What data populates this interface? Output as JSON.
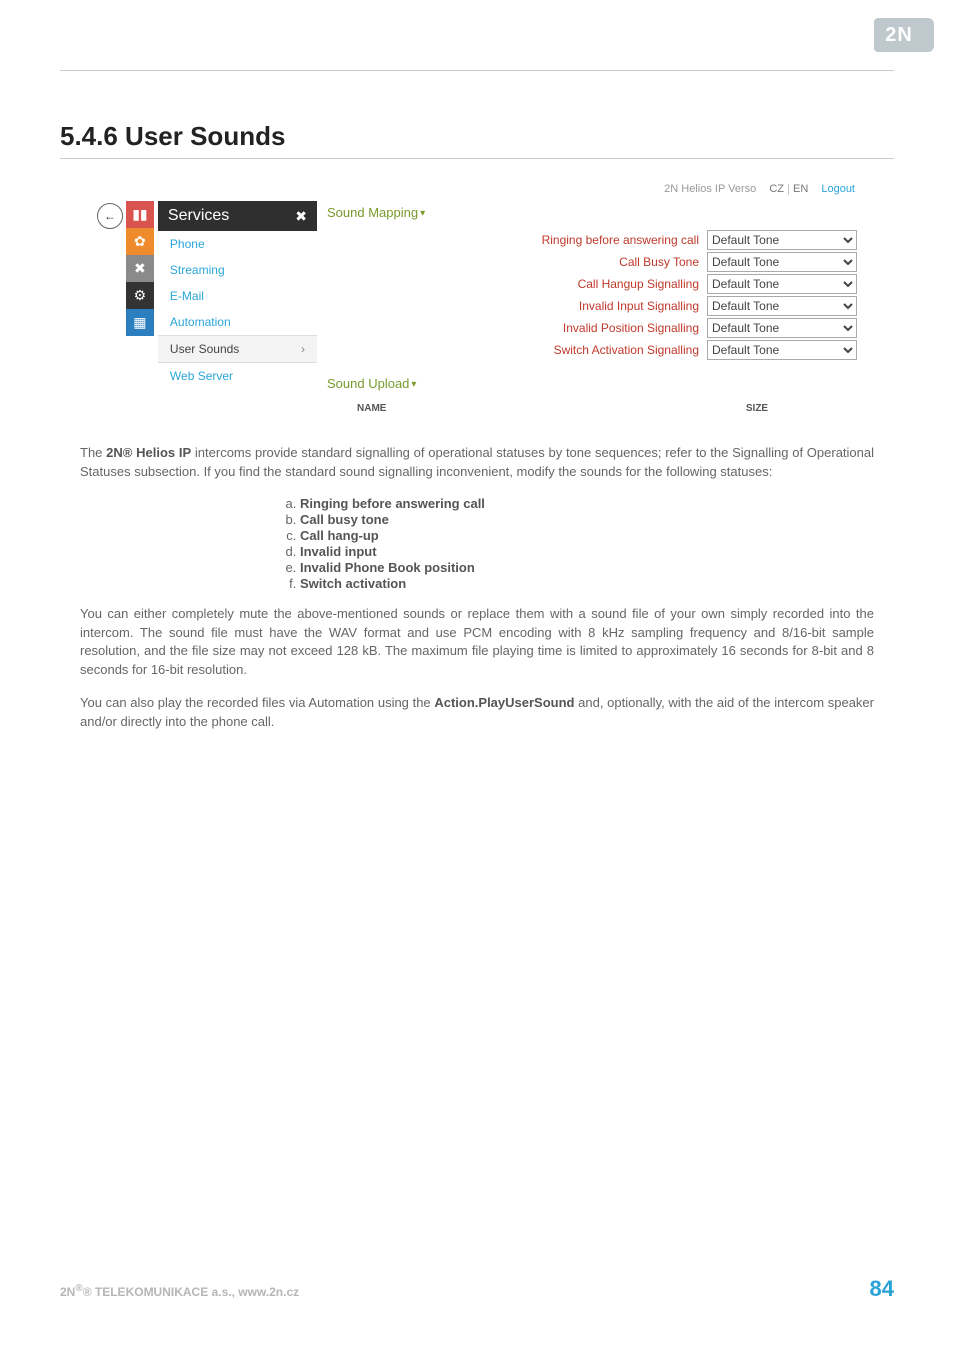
{
  "header": {
    "logo_text": "2N"
  },
  "title": "5.4.6 User Sounds",
  "screenshot": {
    "topbar": {
      "brand": "2N Helios IP Verso",
      "lang_cz": "CZ",
      "lang_en": "EN",
      "logout": "Logout"
    },
    "back_glyph": "←",
    "sidebar": {
      "title": "Services",
      "wrench": "✖",
      "items": [
        {
          "label": "Phone"
        },
        {
          "label": "Streaming"
        },
        {
          "label": "E-Mail"
        },
        {
          "label": "Automation"
        },
        {
          "label": "User Sounds",
          "active": true,
          "chev": "›"
        },
        {
          "label": "Web Server"
        }
      ]
    },
    "panel": {
      "mapping_title": "Sound Mapping",
      "rows": [
        {
          "label": "Ringing before answering call",
          "value": "Default Tone"
        },
        {
          "label": "Call Busy Tone",
          "value": "Default Tone"
        },
        {
          "label": "Call Hangup Signalling",
          "value": "Default Tone"
        },
        {
          "label": "Invalid Input Signalling",
          "value": "Default Tone"
        },
        {
          "label": "Invalid Position Signalling",
          "value": "Default Tone"
        },
        {
          "label": "Switch Activation Signalling",
          "value": "Default Tone"
        }
      ],
      "upload_title": "Sound Upload",
      "upload_cols": {
        "name": "NAME",
        "size": "SIZE"
      }
    }
  },
  "paragraphs": {
    "p1a": "The ",
    "p1b": "2N",
    "p1c": "® Helios IP",
    "p1d": " intercoms provide standard signalling of operational statuses by tone sequences; refer to the Signalling of Operational Statuses subsection. If you find the standard sound signalling inconvenient, modify the sounds for the following statuses:",
    "list": [
      "Ringing before answering call",
      "Call busy tone",
      "Call hang-up",
      "Invalid input",
      "Invalid Phone Book position",
      "Switch activation"
    ],
    "p2": "You can either completely mute the above-mentioned sounds or replace them with a sound file of your own simply recorded into the intercom. The sound file must have the WAV format and use PCM encoding with 8 kHz sampling frequency and 8/16-bit sample resolution, and the file size may not exceed 128 kB. The maximum file playing time is limited to approximately 16 seconds for 8-bit and 8 seconds for 16-bit resolution.",
    "p3a": "You can also play the recorded files via Automation using the ",
    "p3b": "Action.PlayUserSound",
    "p3c": " and, optionally, with the aid of the intercom speaker and/or directly into the phone call."
  },
  "footer": {
    "left_a": "2N",
    "left_b": "® TELEKOMUNIKACE a.s., www.2n.cz",
    "page": "84"
  }
}
